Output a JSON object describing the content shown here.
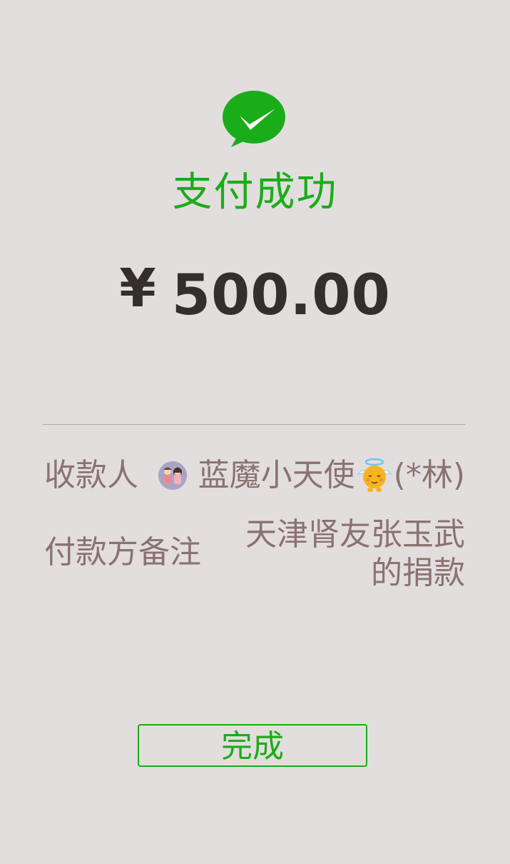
{
  "status": {
    "title": "支付成功",
    "icon": "wechat-pay-check-icon",
    "accent_color": "#1aad19"
  },
  "amount": {
    "currency": "¥",
    "value": "500.00"
  },
  "details": {
    "payee_label": "收款人",
    "payee_name": "蓝魔小天使",
    "payee_masked": "(*林)",
    "payee_avatar_icon": "couple-avatar-icon",
    "payee_emoji_icon": "angel-emoji-icon",
    "note_label": "付款方备注",
    "note_value": "天津肾友张玉武的捐款"
  },
  "actions": {
    "done_label": "完成"
  }
}
